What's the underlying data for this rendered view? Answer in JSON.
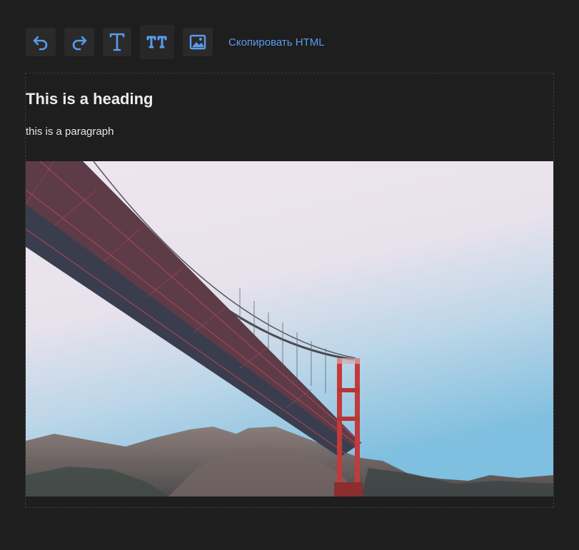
{
  "toolbar": {
    "buttons": [
      {
        "name": "undo-button",
        "icon": "undo-icon"
      },
      {
        "name": "redo-button",
        "icon": "redo-icon"
      },
      {
        "name": "add-text-button",
        "icon": "text-icon"
      },
      {
        "name": "add-heading-button",
        "icon": "heading-icon"
      },
      {
        "name": "add-image-button",
        "icon": "image-icon"
      }
    ],
    "copy_html_label": "Скопировать HTML"
  },
  "content": {
    "heading": "This is a heading",
    "paragraph": "this is a paragraph",
    "image_subject": "golden-gate-bridge-photo"
  },
  "colors": {
    "background": "#1e1e1e",
    "button_bg": "#2a2a2a",
    "accent": "#5a9bf0",
    "text": "#ececec"
  }
}
